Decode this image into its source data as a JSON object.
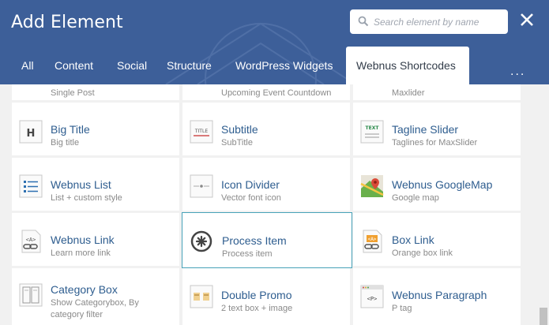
{
  "header": {
    "title": "Add Element",
    "search_placeholder": "Search element by name",
    "colors": {
      "bar": "#3d5f99",
      "link": "#2e5d8f",
      "active_border": "#47a2b8"
    }
  },
  "tabs": [
    {
      "label": "All",
      "active": false
    },
    {
      "label": "Content",
      "active": false
    },
    {
      "label": "Social",
      "active": false
    },
    {
      "label": "Structure",
      "active": false
    },
    {
      "label": "WordPress Widgets",
      "active": false
    },
    {
      "label": "Webnus Shortcodes",
      "active": true
    }
  ],
  "more_label": "...",
  "elements": [
    {
      "name": "Big Title",
      "desc": "Big title",
      "icon": "big-title-icon"
    },
    {
      "name": "Subtitle",
      "desc": "SubTitle",
      "icon": "subtitle-icon"
    },
    {
      "name": "Tagline Slider",
      "desc": "Taglines for MaxSlider",
      "icon": "tagline-slider-icon"
    },
    {
      "name": "Webnus List",
      "desc": "List + custom style",
      "icon": "list-icon"
    },
    {
      "name": "Icon Divider",
      "desc": "Vector font icon",
      "icon": "icon-divider-icon"
    },
    {
      "name": "Webnus GoogleMap",
      "desc": "Google map",
      "icon": "google-map-icon"
    },
    {
      "name": "Webnus Link",
      "desc": "Learn more link",
      "icon": "link-icon"
    },
    {
      "name": "Process Item",
      "desc": "Process item",
      "icon": "process-item-icon"
    },
    {
      "name": "Box Link",
      "desc": "Orange box link",
      "icon": "box-link-icon"
    },
    {
      "name": "Category Box",
      "desc": "Show Categorybox, By category filter",
      "icon": "category-box-icon"
    },
    {
      "name": "Double Promo",
      "desc": "2 text box + image",
      "icon": "double-promo-icon"
    },
    {
      "name": "Webnus Paragraph",
      "desc": "P tag",
      "icon": "paragraph-icon"
    }
  ],
  "partial_top": {
    "left": "Single Post",
    "mid": "Upcoming Event Countdown",
    "right": "Maxlider"
  }
}
